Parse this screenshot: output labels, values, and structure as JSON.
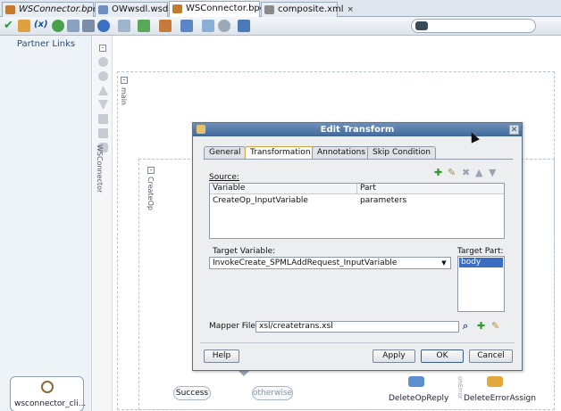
{
  "editor_tabs": [
    {
      "label": "WSConnector.bpel",
      "active": false,
      "icon": "bpel-icon",
      "color": "#c47a2c"
    },
    {
      "label": "OWwsdl.wsdl",
      "active": false,
      "icon": "wsdl-icon",
      "color": "#6e8fbf"
    },
    {
      "label": "WSConnector.bpel",
      "active": true,
      "icon": "bpel-icon",
      "color": "#c47a2c"
    },
    {
      "label": "composite.xml",
      "active": false,
      "icon": "composite-icon",
      "color": "#8a8a8a"
    }
  ],
  "tab_close_glyph": "×",
  "toolbar": {
    "xpath_label": "(x)",
    "icons": [
      "validate-icon",
      "xpath-icon",
      "refresh-icon",
      "image-icon",
      "grid-icon",
      "info-icon",
      "layout-icon",
      "deploy-icon",
      "debug-icon",
      "format-icon",
      "browse-icon",
      "cloud-icon",
      "plugin-icon",
      "binoculars-icon"
    ]
  },
  "left_panel": {
    "title": "Partner Links",
    "connector_label": "wsconnector_cli..."
  },
  "canvas": {
    "main_label": "main",
    "wsconnector_label": "WSConnector",
    "createop_label": "CreateOp",
    "success_label": "Success",
    "otherwise_label": "otherwise",
    "delete_reply_label": "DeleteOpReply",
    "delete_error_label": "DeleteErrorAssign",
    "error_label": "onError"
  },
  "dialog": {
    "title": "Edit Transform",
    "tabs": [
      {
        "label": "General",
        "active": false
      },
      {
        "label": "Transformation",
        "active": true
      },
      {
        "label": "Annotations",
        "active": false
      },
      {
        "label": "Skip Condition",
        "active": false
      }
    ],
    "source_label": "Source:",
    "source_columns": [
      "Variable",
      "Part"
    ],
    "source_rows": [
      {
        "variable": "CreateOp_InputVariable",
        "part": "parameters"
      }
    ],
    "target_variable_label": "Target Variable:",
    "target_variable_value": "InvokeCreate_SPMLAddRequest_InputVariable",
    "target_part_label": "Target Part:",
    "target_part_items": [
      "body"
    ],
    "mapper_file_label": "Mapper File:",
    "mapper_file_value": "xsl/createtrans.xsl",
    "buttons": {
      "help": "Help",
      "apply": "Apply",
      "ok": "OK",
      "cancel": "Cancel"
    },
    "close_glyph": "✕",
    "table_icons": [
      "add-icon",
      "edit-icon",
      "delete-icon",
      "move-up-icon",
      "move-down-icon"
    ],
    "accent_color": "#3f6a9b",
    "active_tab_border": "#d7a43c",
    "selection_color": "#3b6ec3"
  }
}
